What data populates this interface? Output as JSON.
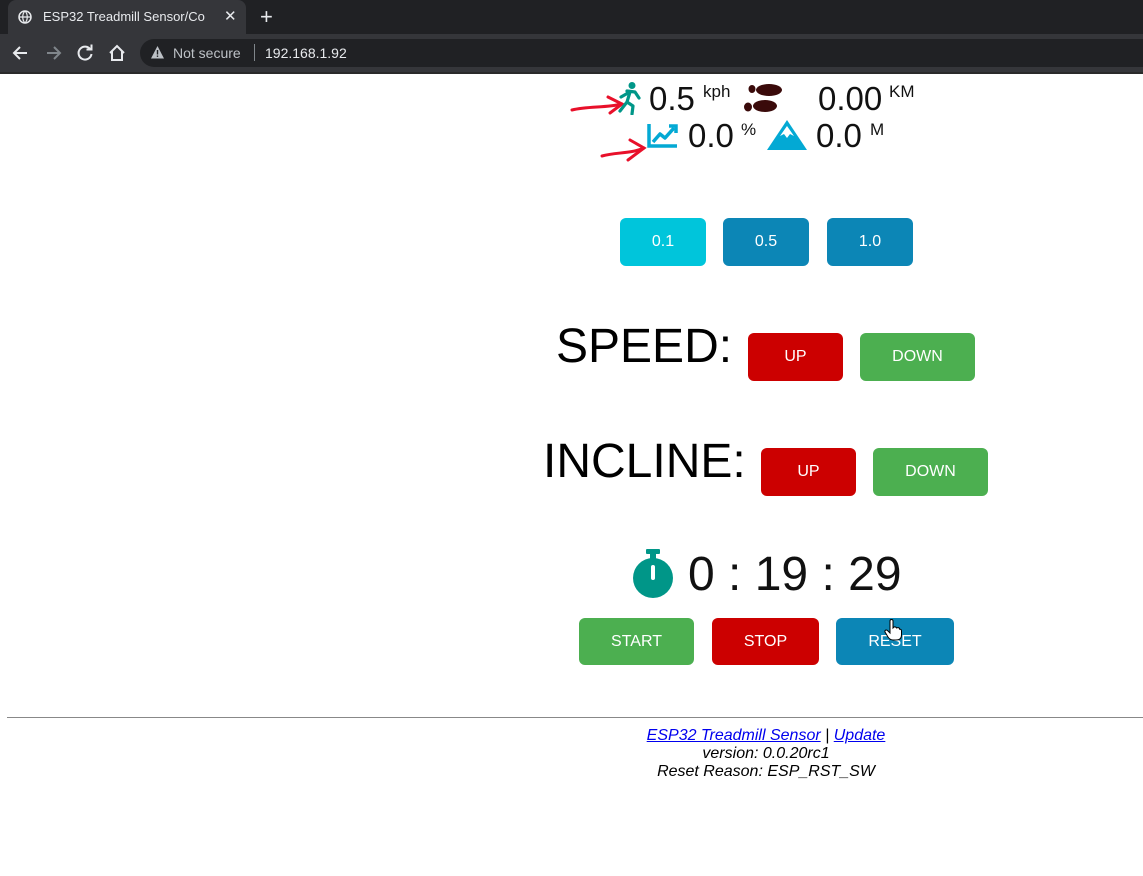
{
  "browser": {
    "tab_title": "ESP32 Treadmill Sensor/Co",
    "security_label": "Not secure",
    "url": "192.168.1.92"
  },
  "stats": {
    "speed": {
      "value": "0.5",
      "unit": "kph"
    },
    "distance": {
      "value": "0.00",
      "unit": "KM"
    },
    "incline": {
      "value": "0.0",
      "unit": "%"
    },
    "elevation": {
      "value": "0.0",
      "unit": "M"
    }
  },
  "step_buttons": [
    {
      "label": "0.1",
      "color": "#00c5db"
    },
    {
      "label": "0.5",
      "color": "#0c86b6"
    },
    {
      "label": "1.0",
      "color": "#0c86b6"
    }
  ],
  "speed_control": {
    "label": "SPEED:",
    "up": "UP",
    "down": "DOWN"
  },
  "incline_control": {
    "label": "INCLINE:",
    "up": "UP",
    "down": "DOWN"
  },
  "timer": {
    "hours": "0",
    "minutes": "19",
    "seconds": "29",
    "separator": ":"
  },
  "timer_buttons": {
    "start": "START",
    "stop": "STOP",
    "reset": "RESET"
  },
  "footer": {
    "link_main": "ESP32 Treadmill Sensor",
    "divider": "|",
    "link_update": "Update",
    "version": "version: 0.0.20rc1",
    "reset_reason": "Reset Reason: ESP_RST_SW"
  },
  "colors": {
    "accent_teal": "#009688",
    "accent_blue": "#03a9d4",
    "red": "#cc0000",
    "green": "#4caf50",
    "blue": "#0c86b6",
    "cyan": "#00c5db"
  }
}
